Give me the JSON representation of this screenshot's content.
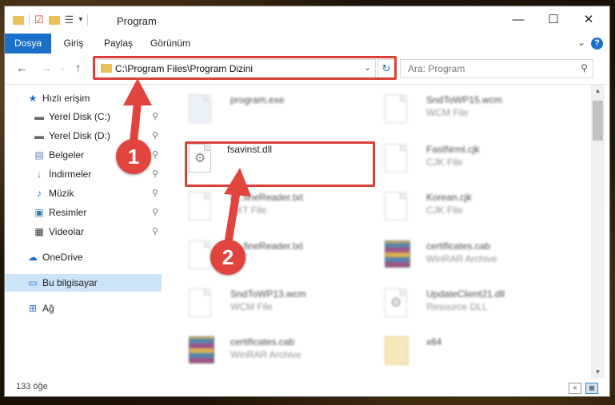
{
  "window": {
    "title": "Program",
    "min_glyph": "—",
    "max_glyph": "☐",
    "close_glyph": "✕"
  },
  "ribbon": {
    "tabs": [
      "Dosya",
      "Giriş",
      "Paylaş",
      "Görünüm"
    ],
    "help_glyph": "?",
    "collapse_glyph": "⌄"
  },
  "address": {
    "path": "C:\\Program Files\\Program Dizini",
    "refresh_glyph": "↻",
    "chevron_glyph": "⌄"
  },
  "search": {
    "placeholder": "Ara: Program",
    "icon": "search-icon"
  },
  "nav": {
    "back": "←",
    "forward": "→",
    "up": "↑",
    "recent": "⌄"
  },
  "sidebar": {
    "quick_access": "Hızlı erişim",
    "items": [
      {
        "label": "Yerel Disk (C:)",
        "icon": "drive-icon",
        "glyph": "▬"
      },
      {
        "label": "Yerel Disk (D:)",
        "icon": "drive-icon",
        "glyph": "▬"
      },
      {
        "label": "Belgeler",
        "icon": "documents-icon",
        "glyph": "▤"
      },
      {
        "label": "İndirmeler",
        "icon": "downloads-icon",
        "glyph": "↓"
      },
      {
        "label": "Müzik",
        "icon": "music-icon",
        "glyph": "♪"
      },
      {
        "label": "Resimler",
        "icon": "pictures-icon",
        "glyph": "▣"
      },
      {
        "label": "Videolar",
        "icon": "videos-icon",
        "glyph": "▦"
      }
    ],
    "onedrive": "OneDrive",
    "this_pc": "Bu bilgisayar",
    "network": "Ağ",
    "pin_glyph": "📌"
  },
  "files": [
    {
      "name": "program.exe",
      "type": "",
      "kind": "exe"
    },
    {
      "name": "SndToWP15.wcm",
      "type": "WCM File",
      "kind": "doc"
    },
    {
      "name": "fsavinst.dll",
      "type": "",
      "kind": "dll"
    },
    {
      "name": "FastNrml.cjk",
      "type": "CJK File",
      "kind": "doc"
    },
    {
      "name": "h...fineReader.txt",
      "type": "TXT File",
      "kind": "doc"
    },
    {
      "name": "Korean.cjk",
      "type": "CJK File",
      "kind": "doc"
    },
    {
      "name": "h...fineReader.txt",
      "type": "...le",
      "kind": "doc"
    },
    {
      "name": "certificates.cab",
      "type": "WinRAR Archive",
      "kind": "rar"
    },
    {
      "name": "SndToWP13.wcm",
      "type": "WCM File",
      "kind": "doc"
    },
    {
      "name": "UpdateClient21.dll",
      "type": "Resource DLL",
      "kind": "dll"
    },
    {
      "name": "certificates.cab",
      "type": "WinRAR Archive",
      "kind": "rar"
    },
    {
      "name": "x64",
      "type": "",
      "kind": "folder"
    }
  ],
  "status": {
    "count": "133 öğe"
  },
  "callouts": {
    "one": "1",
    "two": "2"
  },
  "colors": {
    "accent": "#1a6fc9",
    "callout": "#e0443d",
    "selection": "#cce4f7"
  }
}
